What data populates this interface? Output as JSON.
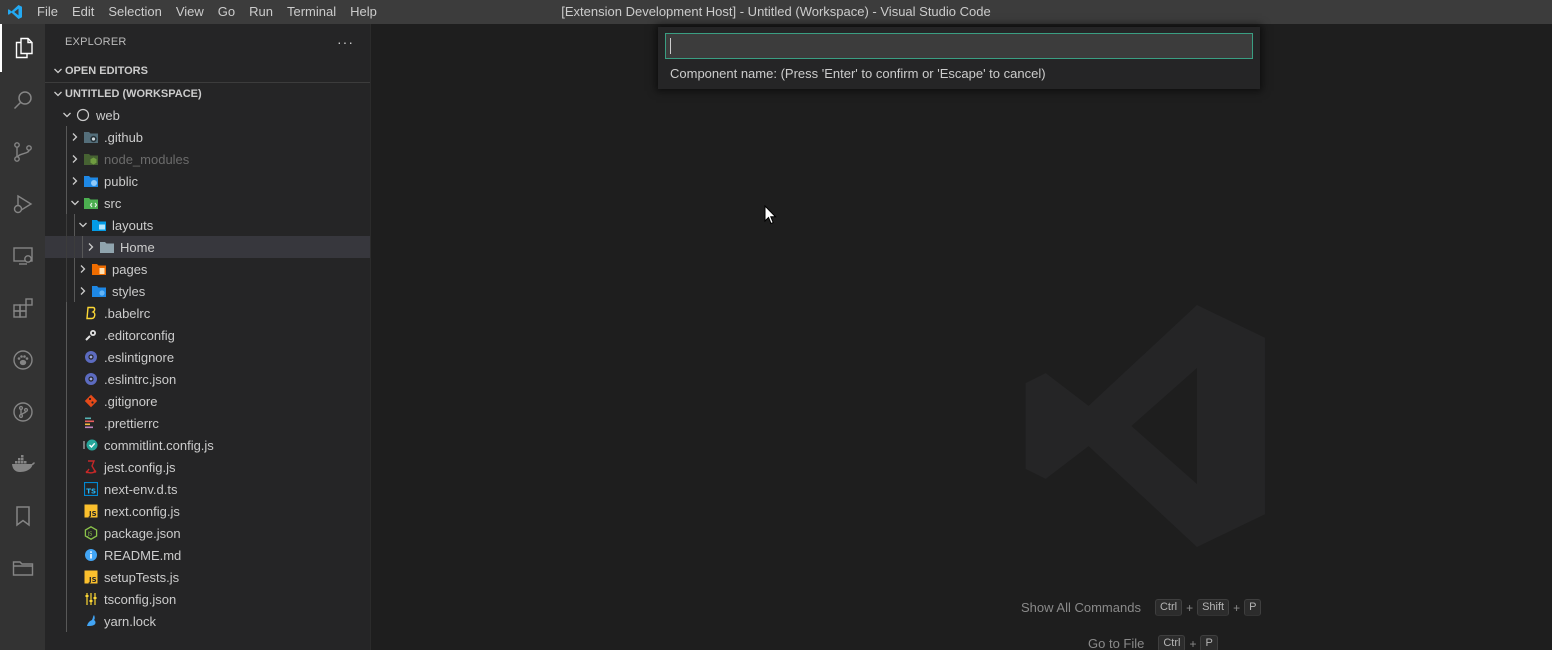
{
  "titlebar": {
    "menu": [
      "File",
      "Edit",
      "Selection",
      "View",
      "Go",
      "Run",
      "Terminal",
      "Help"
    ],
    "window_title": "[Extension Development Host] - Untitled (Workspace) - Visual Studio Code"
  },
  "activitybar": {
    "items": [
      "explorer-icon",
      "search-icon",
      "source-control-icon",
      "run-debug-icon",
      "remote-explorer-icon",
      "extensions-icon",
      "paw-icon",
      "git-graph-icon",
      "docker-icon",
      "bookmark-icon",
      "folder-icon"
    ]
  },
  "sidebar": {
    "title": "EXPLORER",
    "more": "···",
    "open_editors": "OPEN EDITORS",
    "workspace": "UNTITLED (WORKSPACE)",
    "tree": [
      {
        "label": "web",
        "depth": 0,
        "twisty": "open",
        "icon": "root-circle-icon"
      },
      {
        "label": ".github",
        "depth": 1,
        "twisty": "closed",
        "icon": "github-folder-icon"
      },
      {
        "label": "node_modules",
        "depth": 1,
        "twisty": "closed",
        "icon": "node-folder-icon",
        "dim": true
      },
      {
        "label": "public",
        "depth": 1,
        "twisty": "closed",
        "icon": "public-folder-icon"
      },
      {
        "label": "src",
        "depth": 1,
        "twisty": "open",
        "icon": "src-folder-icon"
      },
      {
        "label": "layouts",
        "depth": 2,
        "twisty": "open",
        "icon": "layouts-folder-icon"
      },
      {
        "label": "Home",
        "depth": 3,
        "twisty": "closed",
        "icon": "folder-icon",
        "selected": true
      },
      {
        "label": "pages",
        "depth": 2,
        "twisty": "closed",
        "icon": "pages-folder-icon"
      },
      {
        "label": "styles",
        "depth": 2,
        "twisty": "closed",
        "icon": "styles-folder-icon"
      },
      {
        "label": ".babelrc",
        "depth": 1,
        "twisty": "none",
        "icon": "babel-icon"
      },
      {
        "label": ".editorconfig",
        "depth": 1,
        "twisty": "none",
        "icon": "editorconfig-icon"
      },
      {
        "label": ".eslintignore",
        "depth": 1,
        "twisty": "none",
        "icon": "eslint-icon"
      },
      {
        "label": ".eslintrc.json",
        "depth": 1,
        "twisty": "none",
        "icon": "eslint-icon"
      },
      {
        "label": ".gitignore",
        "depth": 1,
        "twisty": "none",
        "icon": "git-icon"
      },
      {
        "label": ".prettierrc",
        "depth": 1,
        "twisty": "none",
        "icon": "prettier-icon"
      },
      {
        "label": "commitlint.config.js",
        "depth": 1,
        "twisty": "none",
        "icon": "commitlint-icon"
      },
      {
        "label": "jest.config.js",
        "depth": 1,
        "twisty": "none",
        "icon": "jest-icon"
      },
      {
        "label": "next-env.d.ts",
        "depth": 1,
        "twisty": "none",
        "icon": "typescript-icon"
      },
      {
        "label": "next.config.js",
        "depth": 1,
        "twisty": "none",
        "icon": "javascript-icon"
      },
      {
        "label": "package.json",
        "depth": 1,
        "twisty": "none",
        "icon": "nodejs-icon"
      },
      {
        "label": "README.md",
        "depth": 1,
        "twisty": "none",
        "icon": "info-icon"
      },
      {
        "label": "setupTests.js",
        "depth": 1,
        "twisty": "none",
        "icon": "javascript-icon"
      },
      {
        "label": "tsconfig.json",
        "depth": 1,
        "twisty": "none",
        "icon": "tsconfig-icon"
      },
      {
        "label": "yarn.lock",
        "depth": 1,
        "twisty": "none",
        "icon": "yarn-icon"
      }
    ]
  },
  "quick_input": {
    "value": "",
    "message": "Component name: (Press 'Enter' to confirm or 'Escape' to cancel)"
  },
  "editor_hints": [
    {
      "label": "Show All Commands",
      "keys": [
        "Ctrl",
        "Shift",
        "P"
      ]
    },
    {
      "label": "Go to File",
      "keys": [
        "Ctrl",
        "P"
      ]
    }
  ],
  "colors": {
    "titlebar": "#3c3c3c",
    "activitybar": "#333333",
    "sidebar": "#252526",
    "editor": "#1e1e1e",
    "focus_border": "#3a9e82",
    "vscode_blue": "#23a9f2"
  }
}
